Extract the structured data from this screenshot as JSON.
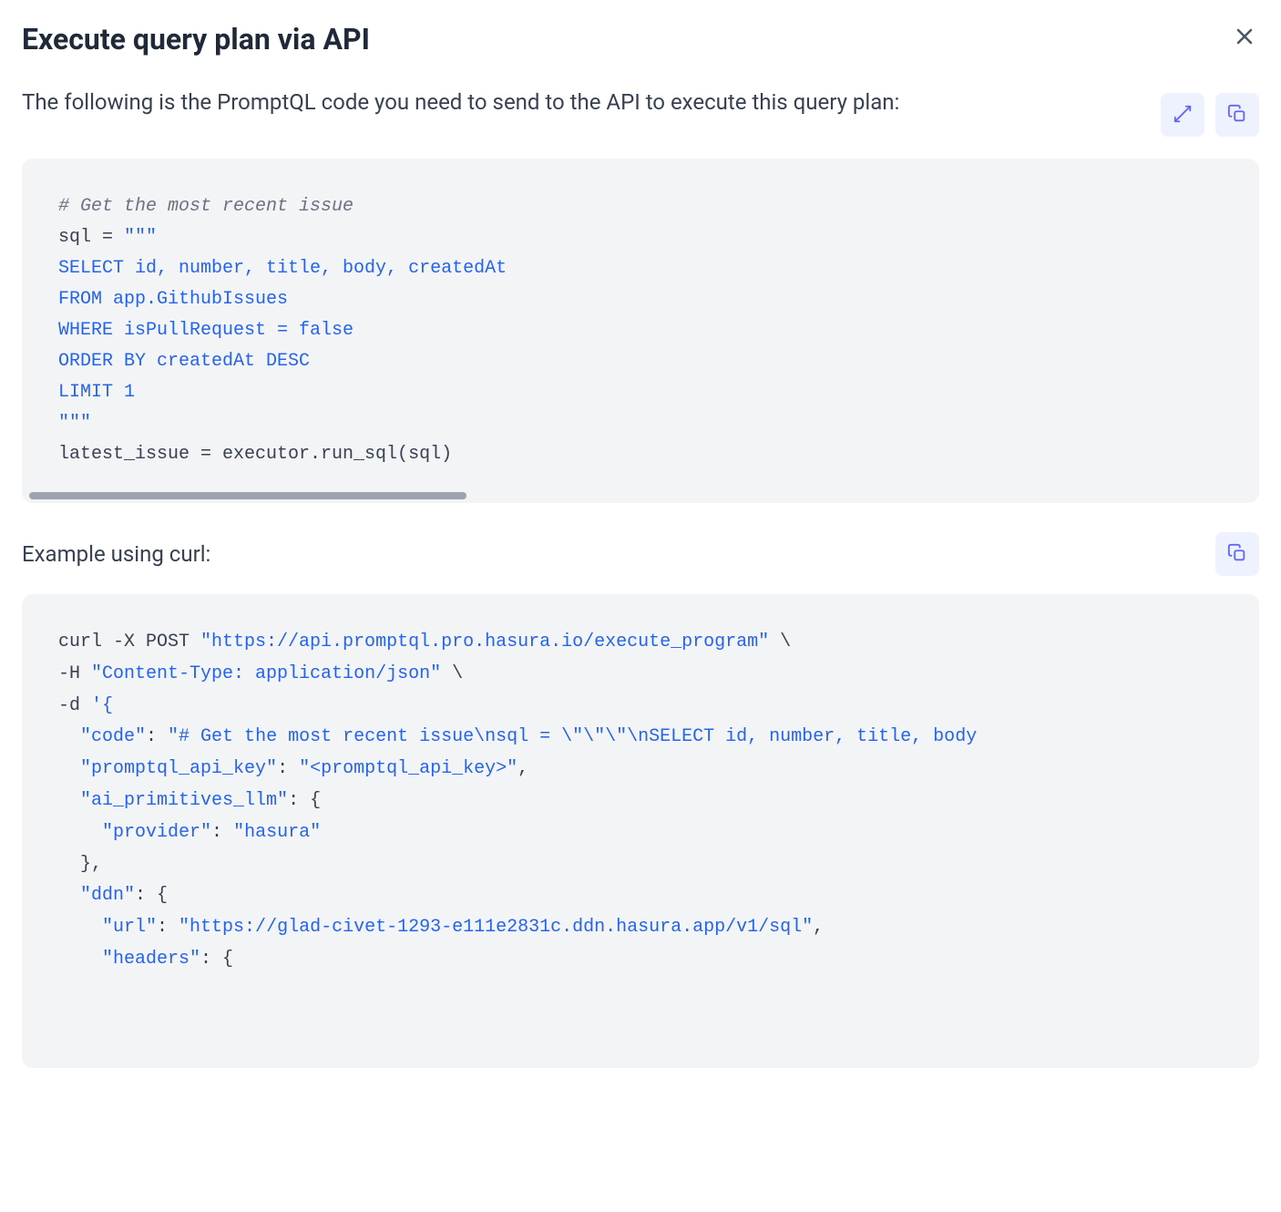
{
  "header": {
    "title": "Execute query plan via API"
  },
  "intro": {
    "text": "The following is the PromptQL code you need to send to the API to execute this query plan:"
  },
  "code1": {
    "comment": "# Get the most recent issue",
    "line_assign_a": "sql = ",
    "line_assign_b": "\"\"\"",
    "sql_select": "SELECT id, number, title, body, createdAt",
    "sql_from": "FROM app.GithubIssues",
    "sql_where": "WHERE isPullRequest = false",
    "sql_order": "ORDER BY createdAt DESC",
    "sql_limit": "LIMIT 1",
    "triple_close": "\"\"\"",
    "exec_line": "latest_issue = executor.run_sql(sql)"
  },
  "example": {
    "label": "Example using curl:"
  },
  "curl": {
    "l1_a": "curl -X POST ",
    "l1_b": "\"https://api.promptql.pro.hasura.io/execute_program\"",
    "l1_c": " \\",
    "l2_a": "-H ",
    "l2_b": "\"Content-Type: application/json\"",
    "l2_c": " \\",
    "l3_a": "-d ",
    "l3_b": "'{",
    "l4_a": "  ",
    "l4_b": "\"code\"",
    "l4_c": ": ",
    "l4_d": "\"# Get the most recent issue\\nsql = \\\"\\\"\\\"\\nSELECT id, number, title, body",
    "l5_a": "  ",
    "l5_b": "\"promptql_api_key\"",
    "l5_c": ": ",
    "l5_d": "\"<promptql_api_key>\"",
    "l5_e": ",",
    "l6_a": "  ",
    "l6_b": "\"ai_primitives_llm\"",
    "l6_c": ": {",
    "l7_a": "    ",
    "l7_b": "\"provider\"",
    "l7_c": ": ",
    "l7_d": "\"hasura\"",
    "l8_a": "  },",
    "l9_a": "  ",
    "l9_b": "\"ddn\"",
    "l9_c": ": {",
    "l10_a": "    ",
    "l10_b": "\"url\"",
    "l10_c": ": ",
    "l10_d": "\"https://glad-civet-1293-e111e2831c.ddn.hasura.app/v1/sql\"",
    "l10_e": ",",
    "l11_a": "    ",
    "l11_b": "\"headers\"",
    "l11_c": ": {"
  }
}
